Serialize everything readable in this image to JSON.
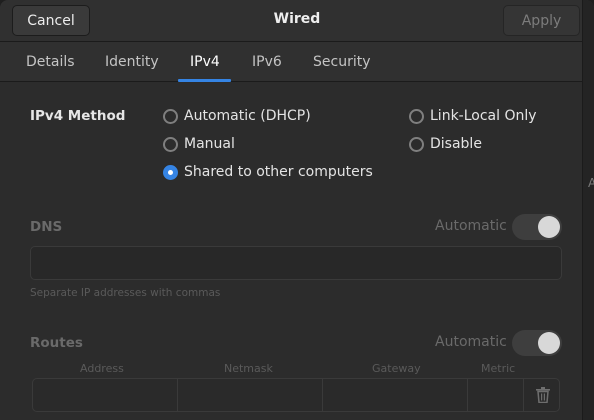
{
  "header": {
    "cancel_label": "Cancel",
    "title": "Wired",
    "apply_label": "Apply"
  },
  "tabs": [
    {
      "label": "Details",
      "active": false
    },
    {
      "label": "Identity",
      "active": false
    },
    {
      "label": "IPv4",
      "active": true
    },
    {
      "label": "IPv6",
      "active": false
    },
    {
      "label": "Security",
      "active": false
    }
  ],
  "ipv4_method": {
    "label": "IPv4 Method",
    "options": [
      {
        "label": "Automatic (DHCP)",
        "checked": false
      },
      {
        "label": "Link-Local Only",
        "checked": false
      },
      {
        "label": "Manual",
        "checked": false
      },
      {
        "label": "Disable",
        "checked": false
      },
      {
        "label": "Shared to other computers",
        "checked": true
      }
    ],
    "selected": "Shared to other computers"
  },
  "dns": {
    "label": "DNS",
    "automatic_label": "Automatic",
    "automatic_on": true,
    "value": "",
    "hint": "Separate IP addresses with commas"
  },
  "routes": {
    "label": "Routes",
    "automatic_label": "Automatic",
    "automatic_on": true,
    "columns": [
      "Address",
      "Netmask",
      "Gateway",
      "Metric"
    ]
  },
  "colors": {
    "accent": "#3584e4",
    "background": "#2c2c2c"
  },
  "icons": {
    "delete_route": "trash-icon"
  }
}
